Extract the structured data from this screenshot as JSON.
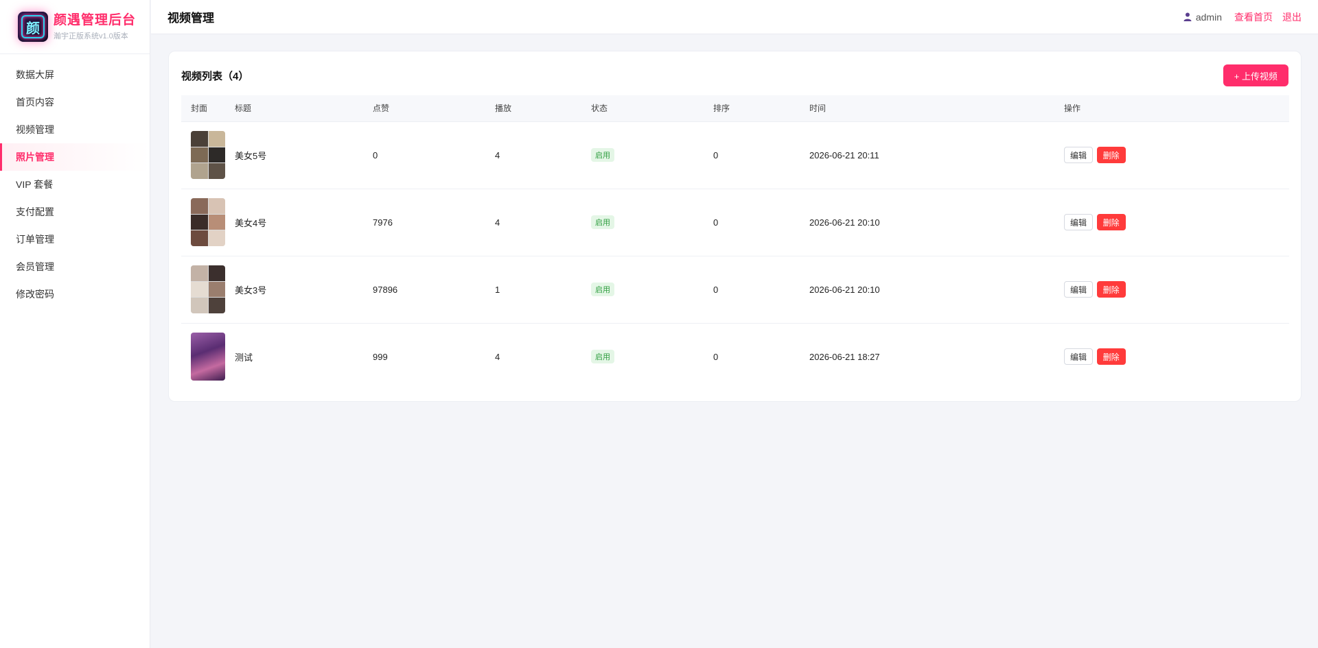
{
  "brand": {
    "title": "颜遇管理后台",
    "subtitle": "瀚宇正版系统v1.0版本",
    "logo_char": "颜"
  },
  "sidebar": {
    "items": [
      {
        "label": "数据大屏",
        "active": false
      },
      {
        "label": "首页内容",
        "active": false
      },
      {
        "label": "视频管理",
        "active": false
      },
      {
        "label": "照片管理",
        "active": true
      },
      {
        "label": "VIP 套餐",
        "active": false
      },
      {
        "label": "支付配置",
        "active": false
      },
      {
        "label": "订单管理",
        "active": false
      },
      {
        "label": "会员管理",
        "active": false
      },
      {
        "label": "修改密码",
        "active": false
      }
    ]
  },
  "header": {
    "title": "视频管理",
    "user_icon": "user-icon",
    "username": "admin",
    "home_link": "查看首页",
    "logout_link": "退出"
  },
  "card": {
    "title": "视频列表（4）",
    "upload_button": "+ 上传视频"
  },
  "table": {
    "headers": [
      "封面",
      "标题",
      "点赞",
      "播放",
      "状态",
      "排序",
      "时间",
      "操作"
    ],
    "rows": [
      {
        "title": "美女5号",
        "likes": "0",
        "plays": "4",
        "status": "启用",
        "sort": "0",
        "time": "2026-06-21 20:11",
        "edit": "编辑",
        "delete": "删除"
      },
      {
        "title": "美女4号",
        "likes": "7976",
        "plays": "4",
        "status": "启用",
        "sort": "0",
        "time": "2026-06-21 20:10",
        "edit": "编辑",
        "delete": "删除"
      },
      {
        "title": "美女3号",
        "likes": "97896",
        "plays": "1",
        "status": "启用",
        "sort": "0",
        "time": "2026-06-21 20:10",
        "edit": "编辑",
        "delete": "删除"
      },
      {
        "title": "测试",
        "likes": "999",
        "plays": "4",
        "status": "启用",
        "sort": "0",
        "time": "2026-06-21 18:27",
        "edit": "编辑",
        "delete": "删除"
      }
    ]
  },
  "colors": {
    "accent": "#ff2d6b",
    "danger": "#ff3b3b",
    "success_text": "#2e9d3f",
    "success_bg": "#e4f6e6"
  }
}
